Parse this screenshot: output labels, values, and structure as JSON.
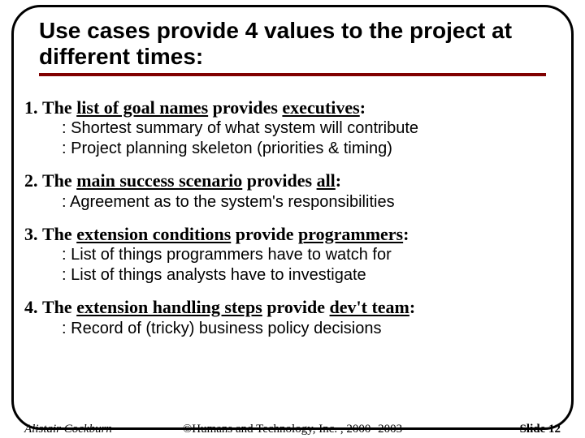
{
  "title": "Use cases provide 4 values to the project at different times:",
  "items": [
    {
      "num": "1.",
      "pre": "The ",
      "ul1": "list of goal names",
      "mid": " provides ",
      "ul2": "executives",
      "post": ":",
      "subs": [
        "Shortest summary of what system will contribute",
        "Project planning skeleton (priorities & timing)"
      ]
    },
    {
      "num": "2.",
      "pre": "The ",
      "ul1": "main success scenario",
      "mid": " provides ",
      "ul2": "all",
      "post": ":",
      "subs": [
        "Agreement as to the system's responsibilities"
      ]
    },
    {
      "num": "3.",
      "pre": "The ",
      "ul1": "extension conditions",
      "mid": " provide ",
      "ul2": "programmers",
      "post": ":",
      "subs": [
        "List of things programmers have to watch for",
        "List of things analysts have to investigate"
      ]
    },
    {
      "num": "4.",
      "pre": "The ",
      "ul1": "extension handling steps",
      "mid": " provide ",
      "ul2": "dev't team",
      "post": ":",
      "subs": [
        "Record of (tricky) business policy decisions"
      ]
    }
  ],
  "footer": {
    "author": "Alistair Cockburn",
    "copyright": "©Humans and Technology, Inc. , 2000 -2003",
    "slidenum": "Slide 12"
  }
}
